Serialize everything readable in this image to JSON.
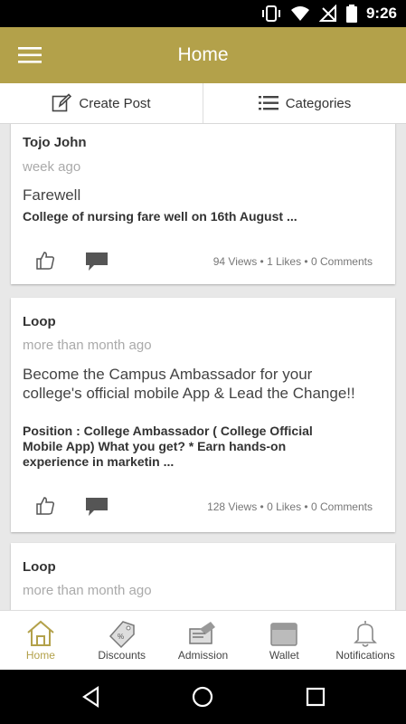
{
  "status": {
    "time": "9:26"
  },
  "appbar": {
    "title": "Home"
  },
  "actions": {
    "create_post": "Create Post",
    "categories": "Categories"
  },
  "posts": [
    {
      "author": "Tojo John",
      "time": "week ago",
      "title": "Farewell",
      "desc": "College of nursing fare well on 16th August ...",
      "stats": "94 Views • 1 Likes • 0 Comments"
    },
    {
      "author": "Loop",
      "time": "more than month ago",
      "title": "Become the Campus Ambassador for your college's official mobile App & Lead the Change!!",
      "desc": "Position : College Ambassador ( College Official Mobile App)  What you get?  * Earn hands-on experience in marketin ...",
      "stats": "128 Views • 0 Likes • 0 Comments"
    },
    {
      "author": "Loop",
      "time": "more than month ago"
    }
  ],
  "nav": {
    "home": "Home",
    "discounts": "Discounts",
    "admission": "Admission",
    "wallet": "Wallet",
    "notifications": "Notifications"
  },
  "colors": {
    "accent": "#b3a14a",
    "background": "#e8e8e8"
  }
}
